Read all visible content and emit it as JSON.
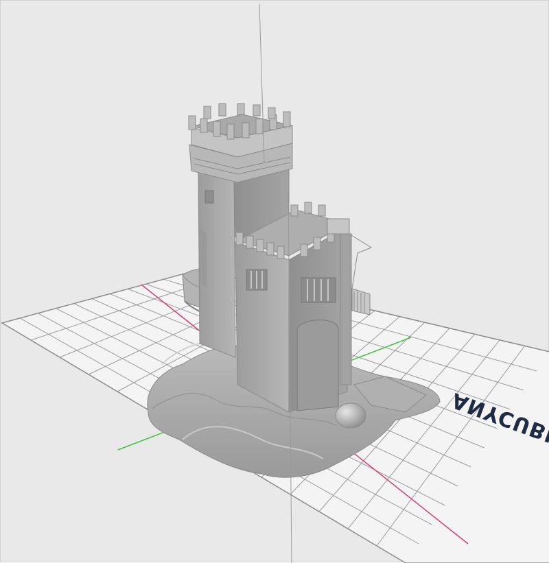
{
  "viewport": {
    "brand_watermark": "ANYCUBIC",
    "colors": {
      "background": "#e9e9e9",
      "plate": "#f4f4f4",
      "grid_line": "#9a9a9a",
      "x_axis": "#d63a78",
      "y_axis": "#3ec23e",
      "model": "#a8a8a8",
      "brand_text": "#1f2a44",
      "brand_accent": "#3a86d6"
    }
  }
}
